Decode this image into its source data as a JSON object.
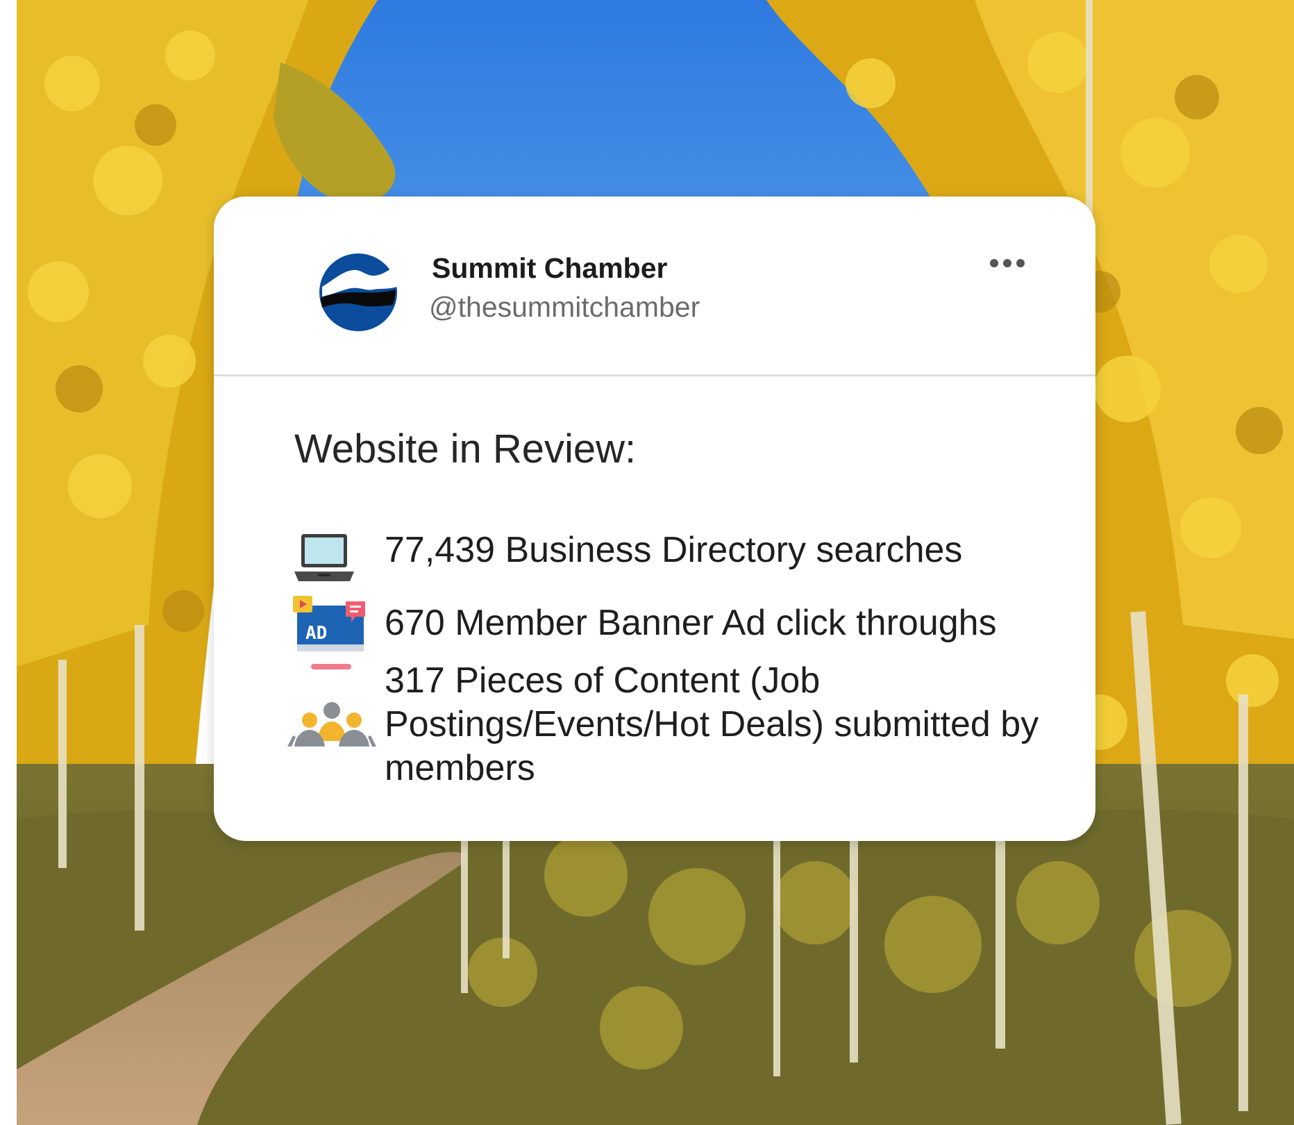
{
  "post": {
    "account": {
      "display_name": "Summit Chamber",
      "handle": "@thesummitchamber",
      "avatar_icon": "mountain-wave-logo-icon"
    },
    "menu_icon": "more-dots-icon",
    "title": "Website in Review:",
    "stats": [
      {
        "icon": "laptop-icon",
        "text": "77,439 Business Directory searches"
      },
      {
        "icon": "ad-monitor-icon",
        "text": "670 Member Banner Ad click throughs"
      },
      {
        "icon": "people-group-icon",
        "text": "317 Pieces of Content (Job Postings/Events/Hot Deals) submitted by members"
      }
    ]
  },
  "colors": {
    "card": "#ffffff",
    "logo_blue": "#0b4d9c",
    "aspen_yellow": "#e2b01c",
    "sky": "#3b86e0"
  }
}
